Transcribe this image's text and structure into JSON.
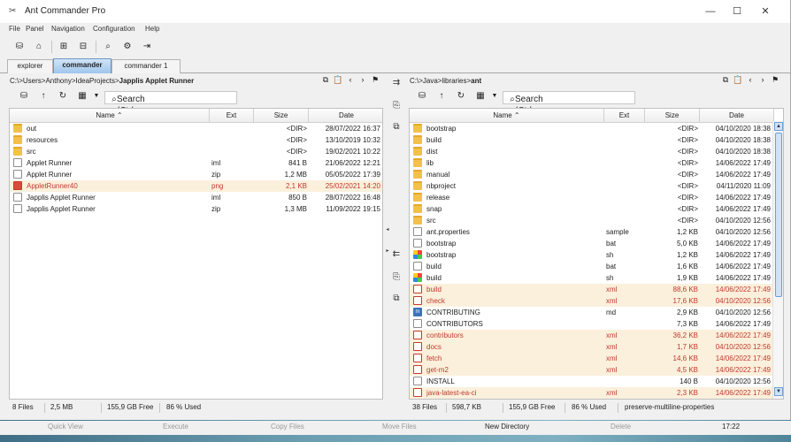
{
  "window": {
    "title": "Ant Commander Pro",
    "minimize": "—",
    "maximize": "☐",
    "close": "✕"
  },
  "menu": [
    "File",
    "Panel",
    "Navigation",
    "Configuration",
    "Help"
  ],
  "tabs": [
    {
      "label": "explorer",
      "active": false
    },
    {
      "label": "commander",
      "active": true
    },
    {
      "label": "commander 1",
      "active": false
    }
  ],
  "left": {
    "path_prefix": "C:\\>Users>Anthony>IdeaProjects>",
    "path_current": "Japplis Applet Runner",
    "search_placeholder": "Search (Ctrl + F)",
    "columns": {
      "name": "Name ⌃",
      "ext": "Ext",
      "size": "Size",
      "date": "Date"
    },
    "rows": [
      {
        "name": "out",
        "ext": "",
        "size": "<DIR>",
        "date": "28/07/2022 16:37",
        "icon": "folder",
        "red": false
      },
      {
        "name": "resources",
        "ext": "",
        "size": "<DIR>",
        "date": "13/10/2019 10:32",
        "icon": "folder",
        "red": false
      },
      {
        "name": "src",
        "ext": "",
        "size": "<DIR>",
        "date": "19/02/2021 10:22",
        "icon": "folder",
        "red": false
      },
      {
        "name": "Applet Runner",
        "ext": "iml",
        "size": "841 B",
        "date": "21/06/2022 12:21",
        "icon": "file",
        "red": false
      },
      {
        "name": "Applet Runner",
        "ext": "zip",
        "size": "1,2 MB",
        "date": "05/05/2022 17:39",
        "icon": "file",
        "red": false
      },
      {
        "name": "AppletRunner40",
        "ext": "png",
        "size": "2,1 KB",
        "date": "25/02/2021 14:20",
        "icon": "img",
        "red": true
      },
      {
        "name": "Japplis Applet Runner",
        "ext": "iml",
        "size": "850 B",
        "date": "28/07/2022 16:48",
        "icon": "file",
        "red": false
      },
      {
        "name": "Japplis Applet Runner",
        "ext": "zip",
        "size": "1,3 MB",
        "date": "11/09/2022 19:15",
        "icon": "file",
        "red": false
      }
    ],
    "status": {
      "files": "8 Files",
      "size": "2,5 MB",
      "free": "155,9 GB Free",
      "used": "86 % Used"
    }
  },
  "right": {
    "path_prefix": "C:\\>Java>libraries>",
    "path_current": "ant",
    "search_placeholder": "Search (Ctrl + F)",
    "columns": {
      "name": "Name ⌃",
      "ext": "Ext",
      "size": "Size",
      "date": "Date"
    },
    "rows": [
      {
        "name": "bootstrap",
        "ext": "",
        "size": "<DIR>",
        "date": "04/10/2020 18:38",
        "icon": "folder",
        "red": false
      },
      {
        "name": "build",
        "ext": "",
        "size": "<DIR>",
        "date": "04/10/2020 18:38",
        "icon": "folder",
        "red": false
      },
      {
        "name": "dist",
        "ext": "",
        "size": "<DIR>",
        "date": "04/10/2020 18:38",
        "icon": "folder",
        "red": false
      },
      {
        "name": "lib",
        "ext": "",
        "size": "<DIR>",
        "date": "14/06/2022 17:49",
        "icon": "folder",
        "red": false
      },
      {
        "name": "manual",
        "ext": "",
        "size": "<DIR>",
        "date": "14/06/2022 17:49",
        "icon": "folder",
        "red": false
      },
      {
        "name": "nbproject",
        "ext": "",
        "size": "<DIR>",
        "date": "04/11/2020 11:09",
        "icon": "folder",
        "red": false
      },
      {
        "name": "release",
        "ext": "",
        "size": "<DIR>",
        "date": "14/06/2022 17:49",
        "icon": "folder",
        "red": false
      },
      {
        "name": "snap",
        "ext": "",
        "size": "<DIR>",
        "date": "14/06/2022 17:49",
        "icon": "folder",
        "red": false
      },
      {
        "name": "src",
        "ext": "",
        "size": "<DIR>",
        "date": "04/10/2020 12:56",
        "icon": "folder",
        "red": false
      },
      {
        "name": "ant.properties",
        "ext": "sample",
        "size": "1,2 KB",
        "date": "04/10/2020 12:56",
        "icon": "file",
        "red": false
      },
      {
        "name": "bootstrap",
        "ext": "bat",
        "size": "5,0 KB",
        "date": "14/06/2022 17:49",
        "icon": "file",
        "red": false
      },
      {
        "name": "bootstrap",
        "ext": "sh",
        "size": "1,2 KB",
        "date": "14/06/2022 17:49",
        "icon": "gimg",
        "red": false
      },
      {
        "name": "build",
        "ext": "bat",
        "size": "1,6 KB",
        "date": "14/06/2022 17:49",
        "icon": "file",
        "red": false
      },
      {
        "name": "build",
        "ext": "sh",
        "size": "1,9 KB",
        "date": "14/06/2022 17:49",
        "icon": "gimg",
        "red": false
      },
      {
        "name": "build",
        "ext": "xml",
        "size": "88,6 KB",
        "date": "14/06/2022 17:49",
        "icon": "redfile",
        "red": true
      },
      {
        "name": "check",
        "ext": "xml",
        "size": "17,6 KB",
        "date": "04/10/2020 12:56",
        "icon": "redfile",
        "red": true
      },
      {
        "name": "CONTRIBUTING",
        "ext": "md",
        "size": "2,9 KB",
        "date": "04/10/2020 12:56",
        "icon": "md",
        "red": false
      },
      {
        "name": "CONTRIBUTORS",
        "ext": "",
        "size": "7,3 KB",
        "date": "14/06/2022 17:49",
        "icon": "file",
        "red": false
      },
      {
        "name": "contributors",
        "ext": "xml",
        "size": "36,2 KB",
        "date": "14/06/2022 17:49",
        "icon": "redfile",
        "red": true
      },
      {
        "name": "docs",
        "ext": "xml",
        "size": "1,7 KB",
        "date": "04/10/2020 12:56",
        "icon": "redfile",
        "red": true
      },
      {
        "name": "fetch",
        "ext": "xml",
        "size": "14,6 KB",
        "date": "14/06/2022 17:49",
        "icon": "redfile",
        "red": true
      },
      {
        "name": "get-m2",
        "ext": "xml",
        "size": "4,5 KB",
        "date": "14/06/2022 17:49",
        "icon": "redfile",
        "red": true
      },
      {
        "name": "INSTALL",
        "ext": "",
        "size": "140 B",
        "date": "04/10/2020 12:56",
        "icon": "file",
        "red": false
      },
      {
        "name": "java-latest-ea-ci",
        "ext": "xml",
        "size": "2,3 KB",
        "date": "14/06/2022 17:49",
        "icon": "redfile",
        "red": true
      }
    ],
    "status": {
      "files": "38 Files",
      "size": "598,7 KB",
      "free": "155,9 GB Free",
      "used": "86 % Used",
      "extra": "preserve-multiline-properties"
    }
  },
  "fkeys": [
    "Quick View",
    "Execute",
    "Copy Files",
    "Move Files",
    "New Directory",
    "Delete"
  ],
  "clock": "17:22"
}
